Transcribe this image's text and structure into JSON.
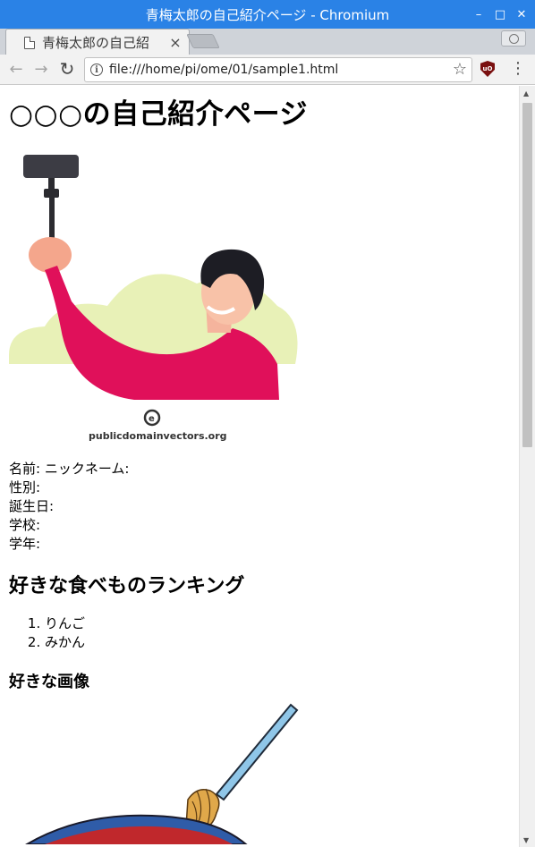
{
  "window": {
    "title": "青梅太郎の自己紹介ページ - Chromium",
    "minimize_glyph": "–",
    "maximize_glyph": "□",
    "close_glyph": "✕"
  },
  "tab": {
    "title": "青梅太郎の自己紹",
    "close_glyph": "×"
  },
  "toolbar": {
    "back_glyph": "←",
    "forward_glyph": "→",
    "reload_glyph": "↻",
    "url": "file:///home/pi/ome/01/sample1.html",
    "info_glyph": "i",
    "star_glyph": "☆",
    "extension_label": "uO",
    "menu_glyph": "⋮"
  },
  "page": {
    "heading": "○○○の自己紹介ページ",
    "selfie_credit": "publicdomainvectors.org",
    "profile_fields": [
      "名前: ニックネーム:",
      "性別:",
      "誕生日:",
      "学校:",
      "学年:"
    ],
    "ranking_heading": "好きな食べものランキング",
    "ranking": [
      "りんご",
      "みかん"
    ],
    "images_heading": "好きな画像"
  },
  "scrollbar": {
    "up_glyph": "▲",
    "down_glyph": "▼",
    "position": 0.0
  }
}
